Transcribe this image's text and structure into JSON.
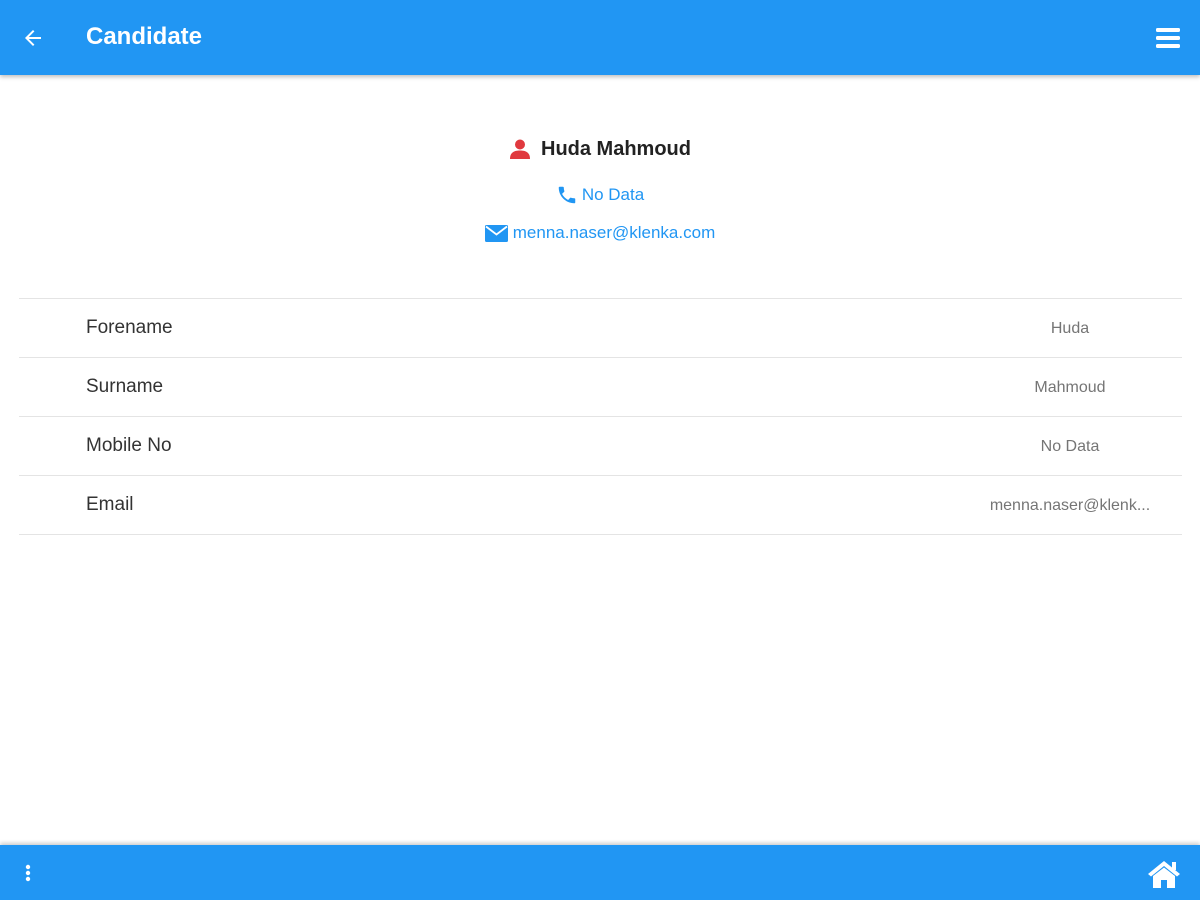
{
  "header": {
    "title": "Candidate",
    "back_icon": "arrow-left-icon",
    "menu_icon": "hamburger-menu-icon",
    "bar_color": "#2196f3"
  },
  "profile": {
    "name": "Huda Mahmoud",
    "person_icon": "person-icon",
    "person_icon_color": "#e0393e",
    "phone": "No Data",
    "phone_icon": "phone-icon",
    "email": "menna.naser@klenka.com",
    "email_icon": "envelope-icon",
    "link_color": "#2196f3"
  },
  "details": [
    {
      "label": "Forename",
      "value": "Huda"
    },
    {
      "label": "Surname",
      "value": "Mahmoud"
    },
    {
      "label": "Mobile No",
      "value": "No Data"
    },
    {
      "label": "Email",
      "value": "menna.naser@klenk..."
    }
  ],
  "footer": {
    "more_icon": "vertical-dots-icon",
    "home_icon": "home-icon"
  }
}
